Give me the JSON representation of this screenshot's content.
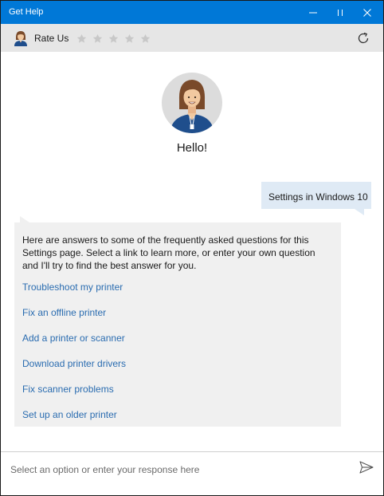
{
  "window": {
    "title": "Get Help"
  },
  "rating": {
    "label": "Rate Us",
    "star_count": 5,
    "selected_stars": 0
  },
  "chat": {
    "greeting": "Hello!",
    "user_message": "Settings in Windows 10",
    "bot_message": "Here are answers to some of the frequently asked questions for this Settings page. Select a link to learn more, or enter your own question and I'll try to find the best answer for you.",
    "links": [
      "Troubleshoot my printer",
      "Fix an offline printer",
      "Add a printer or scanner",
      "Download printer drivers",
      "Fix scanner problems",
      "Set up an older printer"
    ]
  },
  "input": {
    "placeholder": "Select an option or enter your response here",
    "value": ""
  },
  "icons": {
    "minimize": "minimize-icon",
    "maximize": "maximize-icon",
    "close": "close-icon",
    "refresh": "refresh-icon",
    "send": "send-icon",
    "star": "star-icon"
  },
  "colors": {
    "accent": "#0078d7",
    "link": "#2a6cb0",
    "user_bubble": "#dfeaf5",
    "bot_bubble": "#f0f0f0",
    "rate_bar": "#e6e6e6"
  }
}
